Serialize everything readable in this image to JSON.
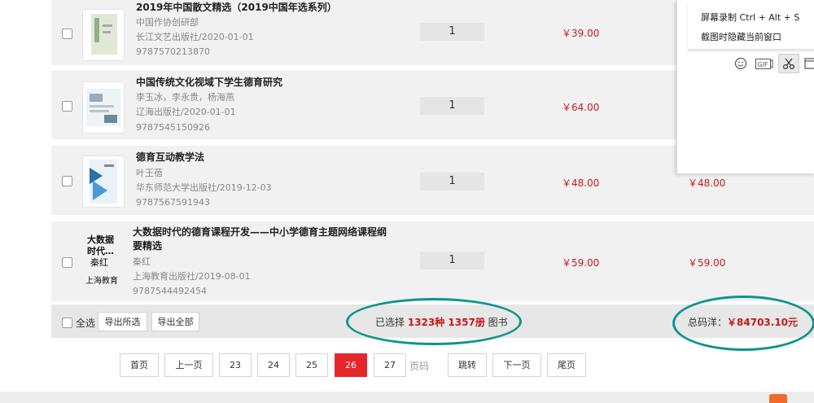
{
  "books": [
    {
      "title": "2019年中国散文精选（2019中国年选系列）",
      "author": "中国作协创研部",
      "publisher": "长江文艺出版社/2020-01-01",
      "isbn": "9787570213870",
      "quantity": "1",
      "price": "￥39.00",
      "subtotal": "",
      "cover_text": ""
    },
    {
      "title": "中国传统文化视域下学生德育研究",
      "author": "李玉冰，李永贵，杨海燕",
      "publisher": "辽海出版社/2020-01-01",
      "isbn": "9787545150926",
      "quantity": "1",
      "price": "￥64.00",
      "subtotal": "",
      "cover_text": ""
    },
    {
      "title": "德育互动教学法",
      "author": "叶王蓓",
      "publisher": "华东师范大学出版社/2019-12-03",
      "isbn": "9787567591943",
      "quantity": "1",
      "price": "￥48.00",
      "subtotal": "￥48.00",
      "cover_text": ""
    },
    {
      "title": "大数据时代的德育课程开发——中小学德育主题网络课程纲要精选",
      "author": "秦红",
      "publisher": "上海教育出版社/2019-08-01",
      "isbn": "9787544492454",
      "quantity": "1",
      "price": "￥59.00",
      "subtotal": "￥59.00",
      "cover_text": {
        "line1": "大数据",
        "line2": "时代…",
        "line3": "秦红",
        "line4": "上海教育"
      }
    }
  ],
  "footer": {
    "select_all": "全选",
    "export_selected": "导出所选",
    "export_all": "导出全部",
    "selected_prefix": "已选择",
    "selected_count": "1323种 1357册",
    "selected_suffix": "图书",
    "total_label": "总码洋：",
    "total_value": "￥84703.10元"
  },
  "pagination": {
    "first": "首页",
    "prev": "上一页",
    "pages": [
      "23",
      "24",
      "25",
      "26",
      "27"
    ],
    "current": "26",
    "page_label": "页码",
    "jump": "跳转",
    "next": "下一页",
    "last": "尾页"
  },
  "popup": {
    "record": "屏幕录制 Ctrl + Alt + S",
    "hide_window": "截图时隐藏当前窗口"
  },
  "colors": {
    "price_red": "#c81818",
    "active_page": "#e5262a",
    "annotation_teal": "#10948f"
  }
}
